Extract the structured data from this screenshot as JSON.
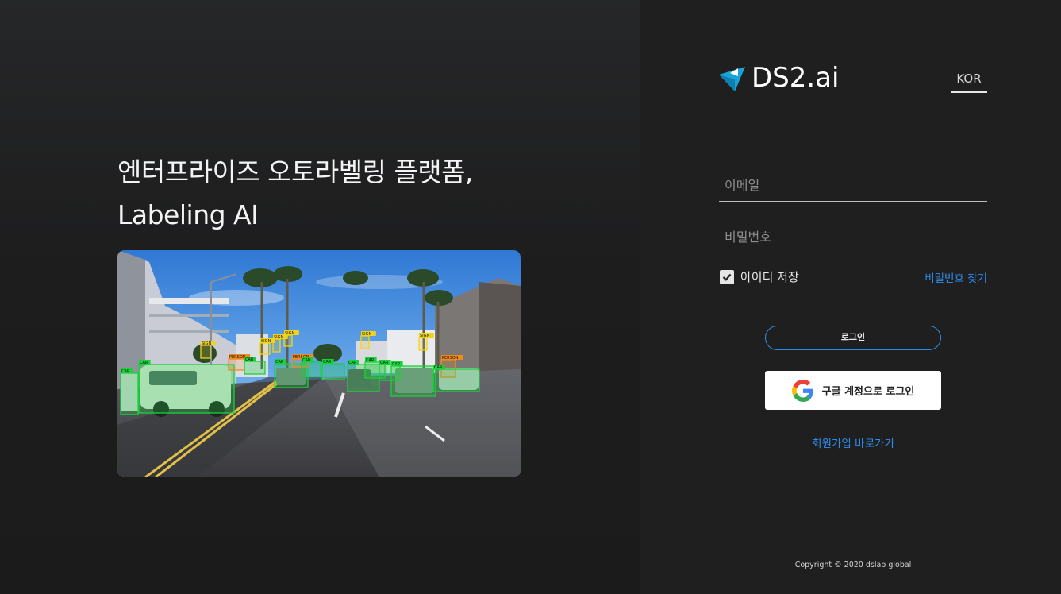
{
  "hero": {
    "line1": "엔터프라이즈 오토라벨링 플랫폼,",
    "line2": "Labeling AI",
    "box_labels": [
      "CAR",
      "CAR",
      "SIGN",
      "PERSON",
      "CAR",
      "SIGN",
      "CAR",
      "SIGN",
      "PERSON",
      "CAR",
      "SIGN",
      "CAR",
      "CAR",
      "CAR",
      "SIGN",
      "CAR",
      "PERSON",
      "SIGN",
      "CAR",
      "CAR"
    ]
  },
  "brand": {
    "name": "DS2.ai",
    "color": "#1aa3d9"
  },
  "language": {
    "current": "KOR"
  },
  "login": {
    "email_placeholder": "이메일",
    "password_placeholder": "비밀번호",
    "remember_label": "아이디 저장",
    "remember_checked": true,
    "forgot_password": "비밀번호 찾기",
    "login_button": "로그인",
    "google_button": "구글 계정으로 로그인",
    "signup_link": "회원가입 바로가기"
  },
  "footer": {
    "copyright": "Copyright © 2020 dslab global"
  },
  "colors": {
    "accent": "#2e8df0",
    "box_green": "#19d23a",
    "box_yellow": "#f2d31b",
    "box_orange": "#f08a1f"
  }
}
